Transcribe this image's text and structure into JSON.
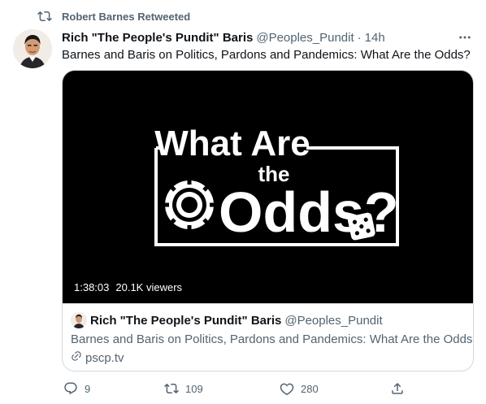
{
  "social_context": {
    "label": "Robert Barnes Retweeted",
    "icon": "retweet-icon"
  },
  "tweet": {
    "author_name": "Rich \"The People's Pundit\" Baris",
    "author_handle": "@Peoples_Pundit",
    "separator": "·",
    "time": "14h",
    "text": "Barnes and Baris on Politics, Pardons and Pandemics: What Are the Odds?",
    "more_icon": "more-icon"
  },
  "media": {
    "logo_line1": "What Are",
    "logo_line2": "the",
    "logo_line3": "Odds?",
    "duration": "1:38:03",
    "viewers": "20.1K viewers"
  },
  "card": {
    "author_name": "Rich \"The People's Pundit\" Baris",
    "author_handle": "@Peoples_Pundit",
    "description": "Barnes and Baris on Politics, Pardons and Pandemics: What Are the Odds?",
    "domain": "pscp.tv"
  },
  "actions": {
    "replies": "9",
    "retweets": "109",
    "likes": "280"
  },
  "colors": {
    "text_primary": "#0f1419",
    "text_secondary": "#536471",
    "border": "#cfd9de"
  }
}
